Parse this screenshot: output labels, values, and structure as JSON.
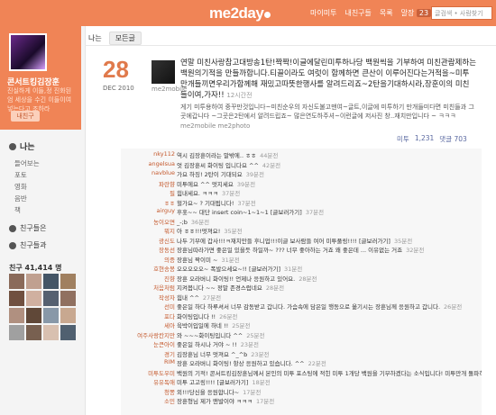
{
  "header": {
    "logo": "me2day",
    "nav": [
      "마이미투",
      "내친구들",
      "목록",
      "말장"
    ],
    "count_badge": "23",
    "search_placeholder": "글검색 • 사람찾기"
  },
  "profile": {
    "name": "콘서트킹김장훈",
    "description": "진실하게 이들,정 진화된 엄 세상을 수긴 이들이여 넣는다고 조하라",
    "follow_label": "내친구"
  },
  "sidebar": {
    "me_label": "나는",
    "items": [
      "들어보는",
      "포토",
      "영화",
      "음반",
      "책"
    ],
    "friends_news": "친구들은",
    "friend_groups": "친구들과",
    "friend_count": "친구 41,414 명"
  },
  "tabs": {
    "me": "나는",
    "all": "모든글"
  },
  "post": {
    "day": "28",
    "month_year": "DEC 2010",
    "user": "me2mobile",
    "text": "연말 미친사랑참고대방송1탄!짝짝!이글에달린미투하나당 백원씩을 기부하여 미친관람제하는 백원의기적을 만들까합니다.티끌이라도 여럿이 함께하면 큰산이 이루어진다는거적을~미투만개들끼면우리가함께해 재밌고따뜻한행사를 알려드리죠~2탄을기대하시라,장훈이의 미친들이여,가자!!",
    "time": "12시간전",
    "sub_text": "게기 미투용하여 중꾸만것입니다~미친순우의 자신도불고맨여~글트,이글에 미투하기 만개들미다면 미친들과 그곳에갑니다 ~그곳은2탄에서 알려드립죠~ 많은연도하주셔~이런글에 저사진 창..재치만입니다 ~ ㅋㅋㅋ",
    "via": "me2mobile me2photo",
    "me2_label": "미투",
    "me2_count": "1,231",
    "comment_count": "댓글 703"
  },
  "comments": [
    {
      "name": "nky112",
      "text": "역시 김장훈이라는 말밖에.. ㅎㅎ",
      "time": "44분전"
    },
    {
      "name": "angelsua",
      "text": "엇 김장훈씨 화이팅 입니다요 ^^",
      "time": "42분전"
    },
    {
      "name": "navblue",
      "text": "가요 하징! 2탄이 기대되요",
      "time": "39분전"
    },
    {
      "name": "파란향",
      "text": "미투에요 ^^ 멋지세요",
      "time": "39분전"
    },
    {
      "name": "필",
      "text": "힘내세요. ㅋㅋㅋ",
      "time": "37분전"
    },
    {
      "name": "ㅎㅎ",
      "text": "헐가요~ ? 기대됩니다!",
      "time": "37분전"
    },
    {
      "name": "airguy",
      "text": "후훗~~ 대단 insert coin~1~1~1 [글보러가기]",
      "time": "37분전"
    },
    {
      "name": "농이오면",
      "text": "_-;b",
      "time": "36분전"
    },
    {
      "name": "뭐지",
      "text": "아 ㅎㅎ!!!멋져요!",
      "time": "35분전"
    },
    {
      "name": "광신도",
      "text": "나두 기부에 갑사!!!ㅋ재치만들 후니업!!!이글 보사람들 여어 미투풀링!!!! [글보러가기]",
      "time": "35분전"
    },
    {
      "name": "장동선",
      "text": "장훈님따라가면 좋은일 있을듯 하일까~ ??? 너무 좋아하는 거죠 왜 좋은데 ... 이유없는 거죠",
      "time": "32분전"
    },
    {
      "name": "의증",
      "text": "장훈님 짝이미 ~",
      "time": "31분전"
    },
    {
      "name": "호현송봉",
      "text": "오오오오오~ 폭발으세요~!! [글보러가기]",
      "time": "31분전"
    },
    {
      "name": "진향",
      "text": "장훈 오라버니 화이팅!! 언제나 응원하고 있어요.",
      "time": "28분전"
    },
    {
      "name": "처음처럼",
      "text": "지켜봅니다 ~~ 정말 존경스럽네요",
      "time": "28분전"
    },
    {
      "name": "작성자",
      "text": "힘내 ^^",
      "time": "27분전"
    },
    {
      "name": "선미",
      "text": "좋은일 하다 하루셔서 너무 감동받고 갑니다. 가슴속에 담은일 행동으로 옮기시는 장훈님께 응원하고 갑니다.",
      "time": "26분전"
    },
    {
      "name": "포다",
      "text": "화이팅입니다 !!",
      "time": "26분전"
    },
    {
      "name": "세아",
      "text": "육박이입일에 하네 !!",
      "time": "25분전"
    },
    {
      "name": "여주사랑칸지만",
      "text": "와 ~~~화이팅입니다 ^^",
      "time": "25분전"
    },
    {
      "name": "눈큰아이",
      "text": "좋은일 하시나 거야 ~ !!",
      "time": "23분전"
    },
    {
      "name": "경기",
      "text": "김장훈님 너무 멋져요 ^_^b",
      "time": "23분전"
    },
    {
      "name": "RIM",
      "text": "장훈 오라버니 화이팅! 항상 응원하고 있습니다. ^^",
      "time": "22분전"
    },
    {
      "name": "미투도우미",
      "text": "백원의 기적! 콘서트킹김장훈님께서 본인의 미투 포스팅에 적힌 미투 1개당 백원을 기부하겠다는 소식입니다! 미투만개 돌파하면 미친들과 함께 재미난 행사를 알려준다고 하네요. 김장훈과 함께하는 미친 기부에, '미투도우미의 미친들이여, 함께하죠!'",
      "time": "22분전"
    },
    {
      "name": "유유독애",
      "text": "미투 고고링!!!! [글보러가기]",
      "time": "18분전"
    },
    {
      "name": "청쫑",
      "text": "외!!!당신을 응원합니다~",
      "time": "17분전"
    },
    {
      "name": "소민",
      "text": "장훈형님 제가 맨발이야 ㅋㅋㅋ",
      "time": "17분전"
    }
  ],
  "colors": {
    "brand": "#f08456",
    "date": "#e07a4c",
    "comment_name": "#c4582c"
  }
}
